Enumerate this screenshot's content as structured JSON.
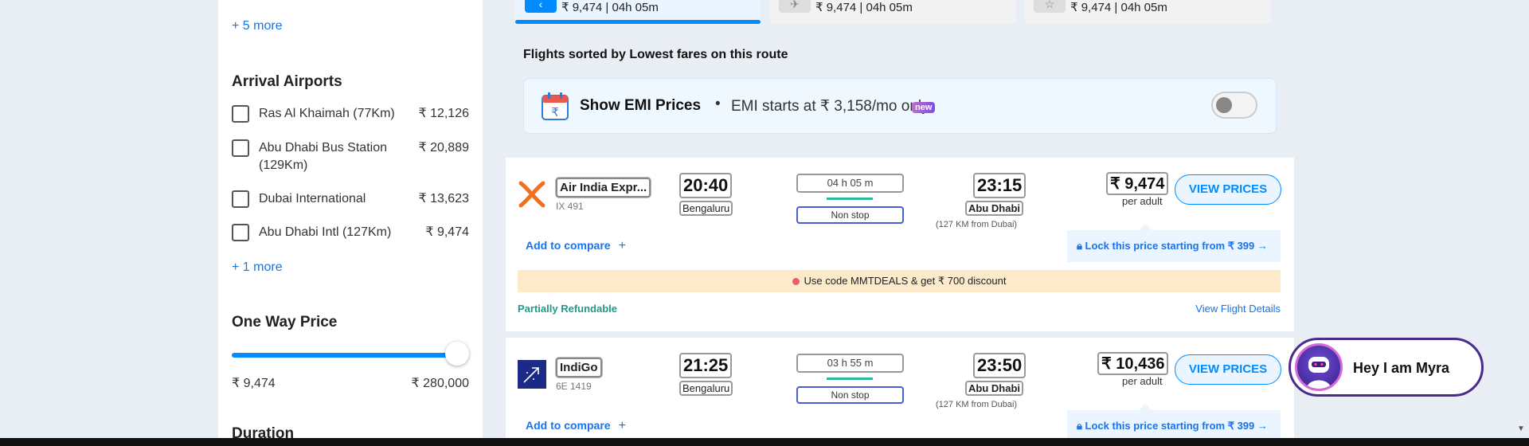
{
  "sidebar": {
    "more_departure": "+ 5 more",
    "arrival_title": "Arrival Airports",
    "arrival_airports": [
      {
        "name": "Ras Al Khaimah (77Km)",
        "price": "₹ 12,126"
      },
      {
        "name": "Abu Dhabi Bus Station (129Km)",
        "price": "₹ 20,889"
      },
      {
        "name": "Dubai International",
        "price": "₹ 13,623"
      },
      {
        "name": "Abu Dhabi Intl (127Km)",
        "price": "₹ 9,474"
      }
    ],
    "more_arrival": "+ 1 more",
    "price_title": "One Way Price",
    "price_min": "₹ 9,474",
    "price_max": "₹ 280,000",
    "price_slider_fraction": 1.0,
    "duration_title": "Duration"
  },
  "date_tabs": [
    {
      "text": "₹ 9,474 | 04h 05m",
      "icon": "chevron-left-icon",
      "active": true
    },
    {
      "text": "₹ 9,474 | 04h 05m",
      "icon": "plane-icon",
      "active": false
    },
    {
      "text": "₹ 9,474 | 04h 05m",
      "icon": "star-icon",
      "active": false
    }
  ],
  "sorted_title": "Flights sorted by Lowest fares on this route",
  "emi": {
    "title": "Show EMI Prices",
    "separator": "•",
    "subtitle": "EMI starts at ₹ 3,158/mo only",
    "badge": "new",
    "toggle_on": false,
    "calendar_symbol": "₹"
  },
  "flights": [
    {
      "airline": "Air India Expr...",
      "flight_no": "IX 491",
      "depart_time": "20:40",
      "depart_city": "Bengaluru",
      "duration": "04 h 05 m",
      "stops": "Non stop",
      "arrive_time": "23:15",
      "arrive_city": "Abu Dhabi",
      "arrive_note": "(127 KM from Dubai)",
      "price": "₹ 9,474",
      "per": "per adult",
      "button": "VIEW PRICES",
      "compare": "Add to compare",
      "lock": "Lock this price starting from ₹ 399",
      "deal": "Use code MMTDEALS & get ₹ 700 discount",
      "refund": "Partially Refundable",
      "details": "View Flight Details"
    },
    {
      "airline": "IndiGo",
      "flight_no": "6E 1419",
      "depart_time": "21:25",
      "depart_city": "Bengaluru",
      "duration": "03 h 55 m",
      "stops": "Non stop",
      "arrive_time": "23:50",
      "arrive_city": "Abu Dhabi",
      "arrive_note": "(127 KM from Dubai)",
      "price": "₹ 10,436",
      "per": "per adult",
      "button": "VIEW PRICES",
      "compare": "Add to compare",
      "lock": "Lock this price starting from ₹ 399"
    }
  ],
  "chatbot": {
    "label": "Hey I am Myra"
  },
  "colors": {
    "accent": "#008cff",
    "refund": "#1f9a8a",
    "deal_bg": "#fdeacb",
    "chat_border": "#4a2a8a"
  }
}
